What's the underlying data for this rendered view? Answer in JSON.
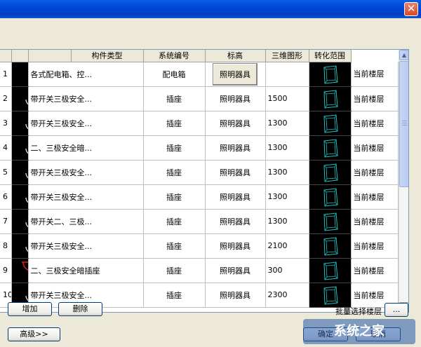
{
  "window": {
    "close_glyph": "✕"
  },
  "table": {
    "headers": [
      "",
      "",
      "",
      "构件类型",
      "系统编号",
      "标高",
      "三维图形",
      "转化范围"
    ],
    "rows": [
      {
        "index": "1",
        "symbol": "vertical-line",
        "symbol_label": "",
        "name": "各式配电箱、控...",
        "type": "配电箱",
        "system": "照明器具",
        "elevation": "",
        "scope": "当前楼层",
        "selected": true
      },
      {
        "index": "2",
        "symbol": "socket",
        "symbol_label": "DR",
        "name": "带开关三极安全...",
        "type": "插座",
        "system": "照明器具",
        "elevation": "1500",
        "scope": "当前楼层",
        "selected": false
      },
      {
        "index": "3",
        "symbol": "socket",
        "symbol_label": "B",
        "name": "带开关三极安全...",
        "type": "插座",
        "system": "照明器具",
        "elevation": "1300",
        "scope": "当前楼层",
        "selected": false
      },
      {
        "index": "4",
        "symbol": "socket",
        "symbol_label": "W",
        "name": "二、三极安全暗...",
        "type": "插座",
        "system": "照明器具",
        "elevation": "1300",
        "scope": "当前楼层",
        "selected": false
      },
      {
        "index": "5",
        "symbol": "socket",
        "symbol_label": "X",
        "name": "带开关三极安全...",
        "type": "插座",
        "system": "照明器具",
        "elevation": "1300",
        "scope": "当前楼层",
        "selected": false
      },
      {
        "index": "6",
        "symbol": "socket",
        "symbol_label": "R",
        "name": "带开关三极安全...",
        "type": "插座",
        "system": "照明器具",
        "elevation": "1300",
        "scope": "当前楼层",
        "selected": false
      },
      {
        "index": "7",
        "symbol": "socket",
        "symbol_label": "C",
        "name": "带开关二、三极...",
        "type": "插座",
        "system": "照明器具",
        "elevation": "1300",
        "scope": "当前楼层",
        "selected": false
      },
      {
        "index": "8",
        "symbol": "socket",
        "symbol_label": "Y",
        "name": "带开关三极安全...",
        "type": "插座",
        "system": "照明器具",
        "elevation": "2100",
        "scope": "当前楼层",
        "selected": false
      },
      {
        "index": "9",
        "symbol": "half-socket",
        "symbol_label": "",
        "name": "二、三极安全暗插座",
        "type": "插座",
        "system": "照明器具",
        "elevation": "300",
        "scope": "当前楼层",
        "selected": false
      },
      {
        "index": "10",
        "symbol": "socket",
        "symbol_label": "H",
        "name": "带开关三极安全...",
        "type": "插座",
        "system": "照明器具",
        "elevation": "2300",
        "scope": "当前楼层",
        "selected": false
      }
    ]
  },
  "buttons": {
    "add": "增加",
    "delete": "删除",
    "batch_label": "批量选择楼层",
    "batch_browse": "...",
    "advanced": "高级>>",
    "ok": "确定",
    "cancel": "取消"
  },
  "watermark": "系统之家",
  "colors": {
    "symbol_line": "#e0e0e0",
    "symbol_red": "#e02020",
    "symbol_cyan": "#20c8c8",
    "view_cyan": "#1ec0c0"
  }
}
